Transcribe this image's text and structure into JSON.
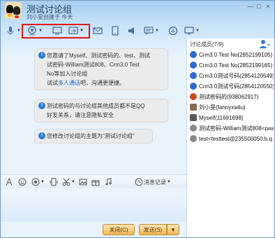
{
  "window": {
    "title": "测试讨论组",
    "subtitle": "刘小旻创建于 今天",
    "min": "—",
    "max": "□",
    "close": "×"
  },
  "toolbar": {
    "items": [
      "microphone-icon",
      "camera-icon",
      "screen-share-icon",
      "remote-assist-icon",
      "email-icon",
      "phone-icon",
      "broadcast-icon",
      "chat-bubble-icon",
      "app-icon",
      "screen-icon"
    ],
    "highlight": "#e01515"
  },
  "messages": [
    {
      "lines": [
        "您邀请了Myself、测试密码的、test、测试",
        "试密码-William测试808、Crm3.0 Test",
        "No等加入讨论组"
      ],
      "tail_prefix": "试试",
      "tail_link": "多人通话",
      "tail_suffix": "吧，沟通更便捷。"
    },
    {
      "lines": [
        "测试密码的与讨论组其他成员都不是QQ",
        "好友关系，请注意隐私安全"
      ]
    },
    {
      "lines": [
        "您修改讨论组的主题为\"测试讨论组\""
      ]
    }
  ],
  "sidebar": {
    "header": "讨论成员(7/9)",
    "members": [
      {
        "name": "Crm3.0 Test No(2852199105)",
        "icon": "penguin",
        "color": "#2a6bd1"
      },
      {
        "name": "Crm3.0 Test No(2852199165)",
        "icon": "penguin",
        "color": "#2a6bd1"
      },
      {
        "name": "Crm3.0测试号码(2854120549)",
        "icon": "penguin",
        "color": "#2a6bd1"
      },
      {
        "name": "Crm3.0测试号码(2854120550)",
        "icon": "penguin",
        "color": "#2a6bd1"
      },
      {
        "name": "测试密码的(938062917)",
        "icon": "qq",
        "color": "#c8471f"
      },
      {
        "name": "刘小旻(fannyxwliu)",
        "icon": "photo",
        "color": "#8c6b4f"
      },
      {
        "name": "Myself(11691698)",
        "icon": "photo",
        "color": "#5a5a5a"
      },
      {
        "name": "测试密码-William测试808<pass...",
        "icon": "gray",
        "color": "#888888"
      },
      {
        "name": "test<testtest@235500050.b.q...",
        "icon": "gray",
        "color": "#888888"
      }
    ]
  },
  "edit_toolbar": {
    "history_label": "消息记录"
  },
  "buttons": {
    "close_label": "关闭(C)",
    "send_label": "发送(S)",
    "send_more": "▼"
  }
}
